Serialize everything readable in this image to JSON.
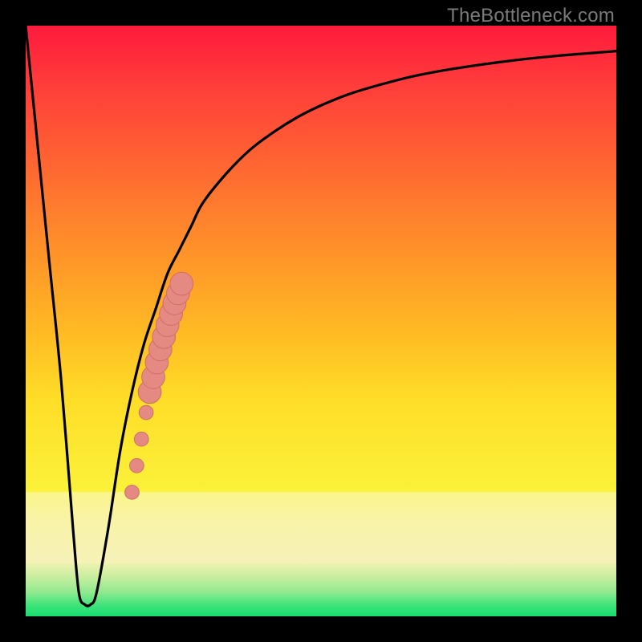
{
  "watermark": "TheBottleneck.com",
  "colors": {
    "frame": "#000000",
    "curve": "#000000",
    "point_fill": "#e48a82",
    "point_stroke": "#d06e66"
  },
  "chart_data": {
    "type": "line",
    "title": "",
    "xlabel": "",
    "ylabel": "",
    "xlim": [
      0,
      100
    ],
    "ylim": [
      0,
      100
    ],
    "series": [
      {
        "name": "bottleneck-curve",
        "x": [
          0,
          2,
          4,
          6,
          8,
          9,
          10,
          11,
          12,
          14,
          16,
          18,
          20,
          22,
          24,
          26,
          28,
          30,
          34,
          38,
          42,
          46,
          50,
          55,
          60,
          65,
          70,
          75,
          80,
          85,
          90,
          95,
          100
        ],
        "y": [
          100,
          80,
          60,
          40,
          15,
          4,
          2,
          2,
          4,
          15,
          28,
          38,
          46,
          52,
          58,
          62,
          66,
          70,
          75,
          79,
          82,
          84.5,
          86.5,
          88.5,
          90,
          91.3,
          92.3,
          93.1,
          93.8,
          94.4,
          94.9,
          95.3,
          95.7
        ]
      }
    ],
    "points": [
      {
        "x": 18.0,
        "y": 21.0,
        "r": 1.6
      },
      {
        "x": 18.8,
        "y": 25.5,
        "r": 1.6
      },
      {
        "x": 19.6,
        "y": 30.0,
        "r": 1.6
      },
      {
        "x": 20.4,
        "y": 34.5,
        "r": 1.6
      },
      {
        "x": 21.0,
        "y": 38.0,
        "r": 2.6
      },
      {
        "x": 21.6,
        "y": 40.5,
        "r": 2.6
      },
      {
        "x": 22.2,
        "y": 43.0,
        "r": 2.6
      },
      {
        "x": 22.8,
        "y": 45.2,
        "r": 2.6
      },
      {
        "x": 23.4,
        "y": 47.3,
        "r": 2.6
      },
      {
        "x": 24.0,
        "y": 49.3,
        "r": 2.6
      },
      {
        "x": 24.6,
        "y": 51.2,
        "r": 2.6
      },
      {
        "x": 25.2,
        "y": 53.0,
        "r": 2.6
      },
      {
        "x": 25.8,
        "y": 54.7,
        "r": 2.6
      },
      {
        "x": 26.4,
        "y": 56.3,
        "r": 2.6
      }
    ]
  }
}
